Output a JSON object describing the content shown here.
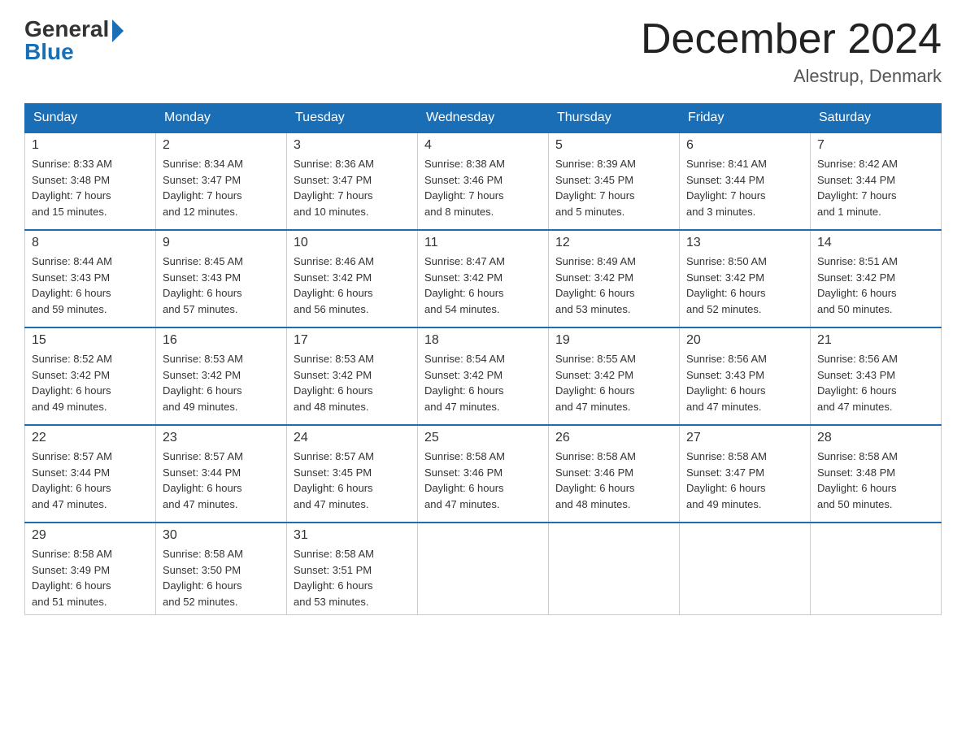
{
  "header": {
    "logo_general": "General",
    "logo_blue": "Blue",
    "month_title": "December 2024",
    "location": "Alestrup, Denmark"
  },
  "days_of_week": [
    "Sunday",
    "Monday",
    "Tuesday",
    "Wednesday",
    "Thursday",
    "Friday",
    "Saturday"
  ],
  "weeks": [
    [
      {
        "num": "1",
        "sunrise": "8:33 AM",
        "sunset": "3:48 PM",
        "daylight": "7 hours and 15 minutes."
      },
      {
        "num": "2",
        "sunrise": "8:34 AM",
        "sunset": "3:47 PM",
        "daylight": "7 hours and 12 minutes."
      },
      {
        "num": "3",
        "sunrise": "8:36 AM",
        "sunset": "3:47 PM",
        "daylight": "7 hours and 10 minutes."
      },
      {
        "num": "4",
        "sunrise": "8:38 AM",
        "sunset": "3:46 PM",
        "daylight": "7 hours and 8 minutes."
      },
      {
        "num": "5",
        "sunrise": "8:39 AM",
        "sunset": "3:45 PM",
        "daylight": "7 hours and 5 minutes."
      },
      {
        "num": "6",
        "sunrise": "8:41 AM",
        "sunset": "3:44 PM",
        "daylight": "7 hours and 3 minutes."
      },
      {
        "num": "7",
        "sunrise": "8:42 AM",
        "sunset": "3:44 PM",
        "daylight": "7 hours and 1 minute."
      }
    ],
    [
      {
        "num": "8",
        "sunrise": "8:44 AM",
        "sunset": "3:43 PM",
        "daylight": "6 hours and 59 minutes."
      },
      {
        "num": "9",
        "sunrise": "8:45 AM",
        "sunset": "3:43 PM",
        "daylight": "6 hours and 57 minutes."
      },
      {
        "num": "10",
        "sunrise": "8:46 AM",
        "sunset": "3:42 PM",
        "daylight": "6 hours and 56 minutes."
      },
      {
        "num": "11",
        "sunrise": "8:47 AM",
        "sunset": "3:42 PM",
        "daylight": "6 hours and 54 minutes."
      },
      {
        "num": "12",
        "sunrise": "8:49 AM",
        "sunset": "3:42 PM",
        "daylight": "6 hours and 53 minutes."
      },
      {
        "num": "13",
        "sunrise": "8:50 AM",
        "sunset": "3:42 PM",
        "daylight": "6 hours and 52 minutes."
      },
      {
        "num": "14",
        "sunrise": "8:51 AM",
        "sunset": "3:42 PM",
        "daylight": "6 hours and 50 minutes."
      }
    ],
    [
      {
        "num": "15",
        "sunrise": "8:52 AM",
        "sunset": "3:42 PM",
        "daylight": "6 hours and 49 minutes."
      },
      {
        "num": "16",
        "sunrise": "8:53 AM",
        "sunset": "3:42 PM",
        "daylight": "6 hours and 49 minutes."
      },
      {
        "num": "17",
        "sunrise": "8:53 AM",
        "sunset": "3:42 PM",
        "daylight": "6 hours and 48 minutes."
      },
      {
        "num": "18",
        "sunrise": "8:54 AM",
        "sunset": "3:42 PM",
        "daylight": "6 hours and 47 minutes."
      },
      {
        "num": "19",
        "sunrise": "8:55 AM",
        "sunset": "3:42 PM",
        "daylight": "6 hours and 47 minutes."
      },
      {
        "num": "20",
        "sunrise": "8:56 AM",
        "sunset": "3:43 PM",
        "daylight": "6 hours and 47 minutes."
      },
      {
        "num": "21",
        "sunrise": "8:56 AM",
        "sunset": "3:43 PM",
        "daylight": "6 hours and 47 minutes."
      }
    ],
    [
      {
        "num": "22",
        "sunrise": "8:57 AM",
        "sunset": "3:44 PM",
        "daylight": "6 hours and 47 minutes."
      },
      {
        "num": "23",
        "sunrise": "8:57 AM",
        "sunset": "3:44 PM",
        "daylight": "6 hours and 47 minutes."
      },
      {
        "num": "24",
        "sunrise": "8:57 AM",
        "sunset": "3:45 PM",
        "daylight": "6 hours and 47 minutes."
      },
      {
        "num": "25",
        "sunrise": "8:58 AM",
        "sunset": "3:46 PM",
        "daylight": "6 hours and 47 minutes."
      },
      {
        "num": "26",
        "sunrise": "8:58 AM",
        "sunset": "3:46 PM",
        "daylight": "6 hours and 48 minutes."
      },
      {
        "num": "27",
        "sunrise": "8:58 AM",
        "sunset": "3:47 PM",
        "daylight": "6 hours and 49 minutes."
      },
      {
        "num": "28",
        "sunrise": "8:58 AM",
        "sunset": "3:48 PM",
        "daylight": "6 hours and 50 minutes."
      }
    ],
    [
      {
        "num": "29",
        "sunrise": "8:58 AM",
        "sunset": "3:49 PM",
        "daylight": "6 hours and 51 minutes."
      },
      {
        "num": "30",
        "sunrise": "8:58 AM",
        "sunset": "3:50 PM",
        "daylight": "6 hours and 52 minutes."
      },
      {
        "num": "31",
        "sunrise": "8:58 AM",
        "sunset": "3:51 PM",
        "daylight": "6 hours and 53 minutes."
      },
      {
        "num": "",
        "sunrise": "",
        "sunset": "",
        "daylight": ""
      },
      {
        "num": "",
        "sunrise": "",
        "sunset": "",
        "daylight": ""
      },
      {
        "num": "",
        "sunrise": "",
        "sunset": "",
        "daylight": ""
      },
      {
        "num": "",
        "sunrise": "",
        "sunset": "",
        "daylight": ""
      }
    ]
  ]
}
